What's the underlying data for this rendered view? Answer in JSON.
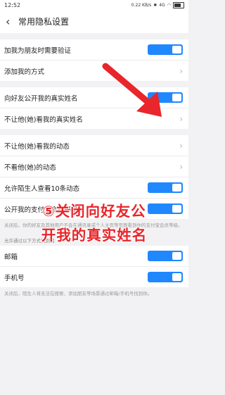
{
  "status": {
    "time": "12:52",
    "speed": "0.22 KB/s",
    "net": "4G"
  },
  "header": {
    "back_icon": "‹",
    "title": "常用隐私设置"
  },
  "section1": [
    {
      "label": "加我为朋友时需要验证",
      "control": "toggle",
      "on": true
    },
    {
      "label": "添加我的方式",
      "control": "chevron"
    }
  ],
  "section2": [
    {
      "label": "向好友公开我的真实姓名",
      "control": "toggle",
      "on": true
    },
    {
      "label": "不让他(她)看我的真实姓名",
      "control": "chevron"
    }
  ],
  "section3": [
    {
      "label": "不让他(她)看我的动态",
      "control": "chevron"
    },
    {
      "label": "不看他(她)的动态",
      "control": "chevron"
    },
    {
      "label": "允许陌生人查看10条动态",
      "control": "toggle",
      "on": true
    },
    {
      "label": "公开我的支付宝会员等级",
      "control": "toggle",
      "on": true
    }
  ],
  "note1": "关闭后，你的好友及其他用户不会在通讯录或个人主页等页面看到你的支付宝会员等级。",
  "group_label": "允许通过以下方式找到我",
  "section4": [
    {
      "label": "邮箱",
      "control": "toggle",
      "on": true
    },
    {
      "label": "手机号",
      "control": "toggle",
      "on": true
    }
  ],
  "note2": "关闭后，陌生人将无法在搜索、添加朋友等场景通过邮箱/手机号找到你。",
  "overlay": {
    "line1": "⑤关闭向好友公",
    "line2": "开我的真实姓名",
    "color": "#e8262b"
  },
  "colors": {
    "toggle": "#1f88ff"
  }
}
